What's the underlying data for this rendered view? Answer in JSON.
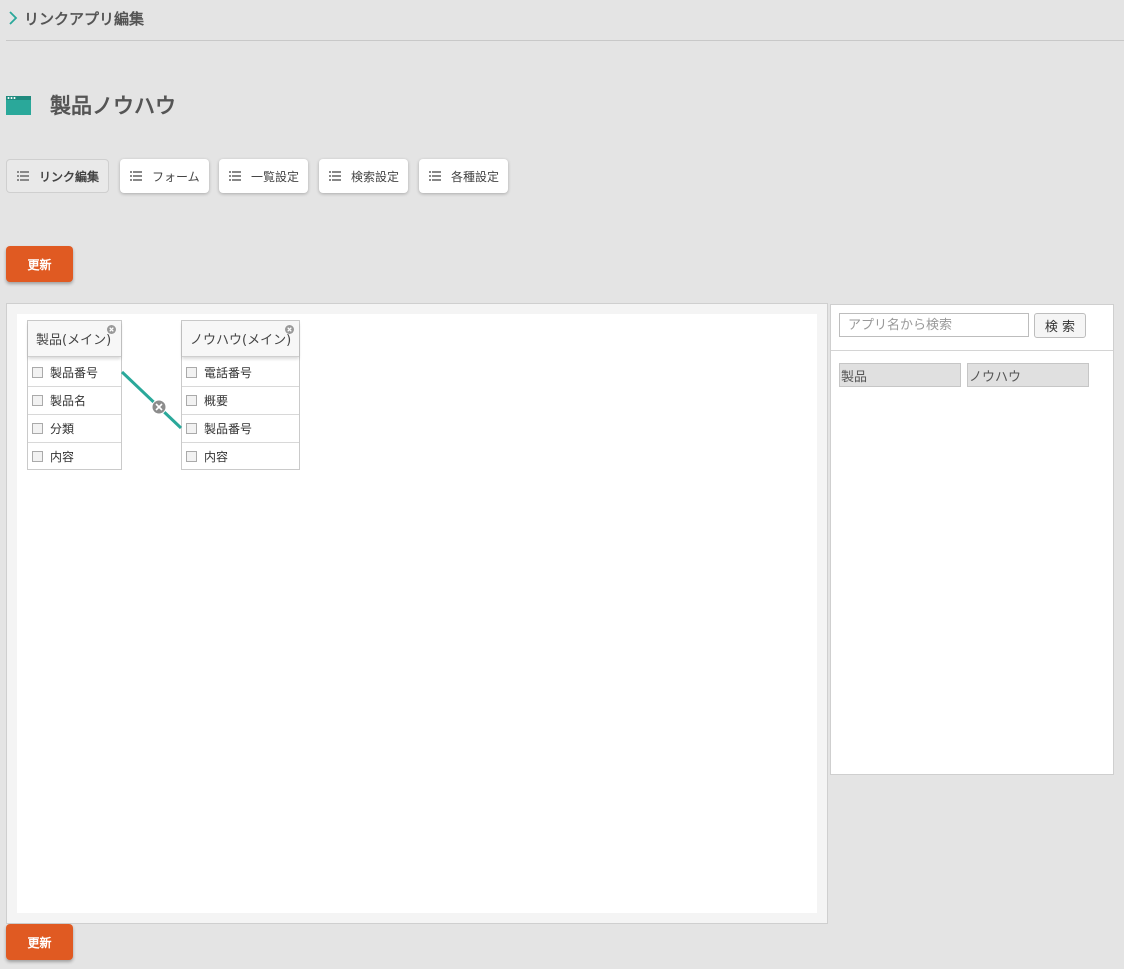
{
  "breadcrumb": {
    "text": "リンクアプリ編集"
  },
  "page": {
    "title": "製品ノウハウ"
  },
  "tabs": [
    {
      "label": "リンク編集",
      "active": true
    },
    {
      "label": "フォーム"
    },
    {
      "label": "一覧設定"
    },
    {
      "label": "検索設定"
    },
    {
      "label": "各種設定"
    }
  ],
  "update_label": "更新",
  "tables": [
    {
      "title": "製品(メイン)",
      "fields": [
        "製品番号",
        "製品名",
        "分類",
        "内容"
      ]
    },
    {
      "title": "ノウハウ(メイン)",
      "fields": [
        "電話番号",
        "概要",
        "製品番号",
        "内容"
      ]
    }
  ],
  "links": [
    {
      "from_table": "製品(メイン)",
      "from_field": "製品番号",
      "to_table": "ノウハウ(メイン)",
      "to_field": "製品番号"
    }
  ],
  "search": {
    "placeholder": "アプリ名から検索",
    "button_label": "検 索"
  },
  "apps": [
    "製品",
    "ノウハウ"
  ],
  "colors": {
    "accent": "#2aa89a",
    "update_button": "#e05a22",
    "background": "#e4e4e4"
  },
  "icons": {
    "breadcrumb": "chevron-right-icon",
    "app": "app-window-icon",
    "tab": "list-icon",
    "remove": "close-circle-icon"
  }
}
